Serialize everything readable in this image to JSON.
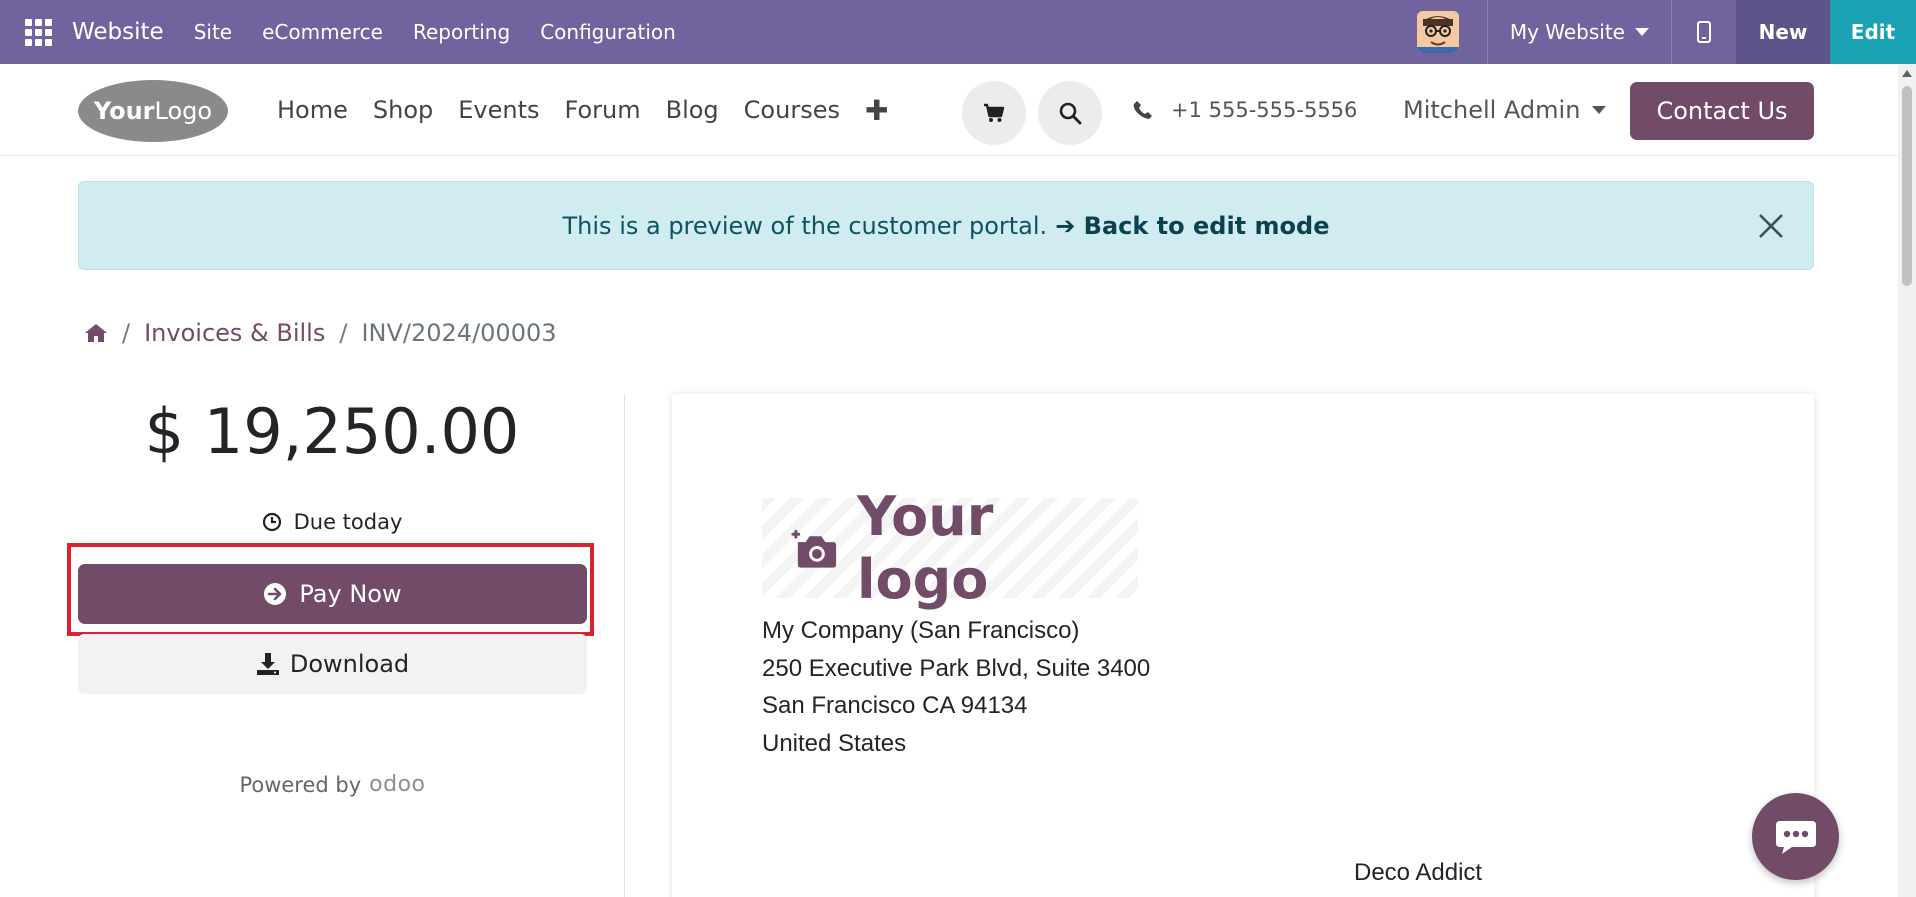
{
  "topbar": {
    "brand": "Website",
    "menu": [
      "Site",
      "eCommerce",
      "Reporting",
      "Configuration"
    ],
    "site_selector": "My Website",
    "new_label": "New",
    "edit_label": "Edit"
  },
  "header": {
    "logo_text_bold": "Your",
    "logo_text_light": "Logo",
    "nav": [
      "Home",
      "Shop",
      "Events",
      "Forum",
      "Blog",
      "Courses"
    ],
    "phone": "+1 555-555-5556",
    "user": "Mitchell Admin",
    "contact_label": "Contact Us"
  },
  "banner": {
    "text": "This is a preview of the customer portal.",
    "link": "➔ Back to edit mode"
  },
  "breadcrumb": {
    "items": [
      "Invoices & Bills"
    ],
    "current": "INV/2024/00003"
  },
  "sidebar": {
    "amount": "$ 19,250.00",
    "due": "Due today",
    "pay_label": "Pay Now",
    "download_label": "Download",
    "powered_by": "Powered by",
    "odoo": "odoo"
  },
  "invoice": {
    "logo_text": "Your logo",
    "company_address": [
      "My Company (San Francisco)",
      "250 Executive Park Blvd, Suite 3400",
      "San Francisco CA 94134",
      "United States"
    ],
    "customer_name": "Deco Addict"
  },
  "colors": {
    "topbar": "#71639e",
    "brand_primary": "#714b67",
    "edit": "#1aa1b2",
    "banner_bg": "#d1ecf1",
    "highlight": "#d9232e"
  }
}
